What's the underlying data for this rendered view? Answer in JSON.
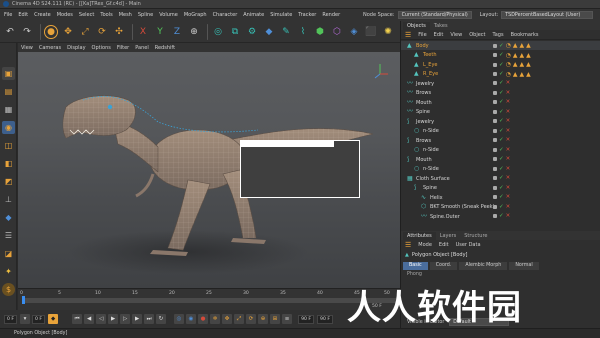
{
  "window": {
    "title": "Cinema 4D S24.111 (RC) - [[Ka]TRex_Gf.c4d] - Main"
  },
  "menubar": {
    "items": [
      "File",
      "Edit",
      "Create",
      "Modes",
      "Select",
      "Tools",
      "Mesh",
      "Spline",
      "Volume",
      "MoGraph",
      "Character",
      "Animate",
      "Simulate",
      "Tracker",
      "Render"
    ],
    "node_space_label": "Node Space:",
    "node_space_value": "Current (Standard/Physical)",
    "layout_label": "Layout:",
    "layout_value": "TSDPercentBasedLayout (User)"
  },
  "viewport": {
    "menu": [
      "View",
      "Cameras",
      "Display",
      "Options",
      "Filter",
      "Panel",
      "Redshift"
    ]
  },
  "timeline": {
    "ticks": [
      "0",
      "5",
      "10",
      "15",
      "20",
      "25",
      "30",
      "35",
      "40",
      "45",
      "50"
    ],
    "frame_marker": "50 F"
  },
  "playback": {
    "start_field": "0 F",
    "current_field": "0 F",
    "end_field": "90 F",
    "end_field2": "90 F"
  },
  "status": {
    "text": "Polygon Object [Body]"
  },
  "objects_panel": {
    "tabs": [
      "Objects",
      "Takes"
    ],
    "menu": [
      "File",
      "Edit",
      "View",
      "Object",
      "Tags",
      "Bookmarks"
    ],
    "rows": [
      {
        "name": "Body",
        "level": 0,
        "icon": "polygon-icon",
        "selected": true,
        "orange": true
      },
      {
        "name": "Teeth",
        "level": 1,
        "icon": "polygon-icon",
        "orange": true
      },
      {
        "name": "L_Eye",
        "level": 1,
        "icon": "polygon-icon",
        "orange": true
      },
      {
        "name": "R_Eye",
        "level": 1,
        "icon": "polygon-icon",
        "orange": true
      },
      {
        "name": "Jewelry",
        "level": 0,
        "icon": "spline-icon"
      },
      {
        "name": "Brows",
        "level": 0,
        "icon": "spline-icon"
      },
      {
        "name": "Mouth",
        "level": 0,
        "icon": "spline-icon"
      },
      {
        "name": "Spine",
        "level": 0,
        "icon": "spline-icon"
      },
      {
        "name": "Jewelry",
        "level": 0,
        "icon": "sweep-icon"
      },
      {
        "name": "n-Side",
        "level": 1,
        "icon": "circle-icon"
      },
      {
        "name": "Brows",
        "level": 0,
        "icon": "sweep-icon"
      },
      {
        "name": "n-Side",
        "level": 1,
        "icon": "circle-icon"
      },
      {
        "name": "Mouth",
        "level": 0,
        "icon": "sweep-icon"
      },
      {
        "name": "n-Side",
        "level": 1,
        "icon": "circle-icon"
      },
      {
        "name": "Cloth Surface",
        "level": 0,
        "icon": "cloth-icon"
      },
      {
        "name": "Spine",
        "level": 1,
        "icon": "sweep-icon"
      },
      {
        "name": "Helix",
        "level": 2,
        "icon": "helix-icon"
      },
      {
        "name": "BKT Smooth (Sneak Peek)",
        "level": 2,
        "icon": "deformer-icon"
      },
      {
        "name": "Spine.Outer",
        "level": 2,
        "icon": "spline-icon"
      }
    ]
  },
  "attributes_panel": {
    "tabs": [
      "Attributes",
      "Layers",
      "Structure"
    ],
    "menu": [
      "Mode",
      "Edit",
      "User Data"
    ],
    "title": "Polygon Object [Body]",
    "buttons": [
      "Basic",
      "Coord.",
      "Alembic Morph",
      "Normal"
    ],
    "active_button": "Basic",
    "phong_label": "Phong",
    "visible_label": "Visible in Editor",
    "visible_value": "Default"
  },
  "watermark": {
    "text": "人人软件园"
  },
  "colors": {
    "accent_orange": "#e8a33a",
    "accent_teal": "#37c1b6",
    "selection_blue": "#4a6d9c"
  }
}
